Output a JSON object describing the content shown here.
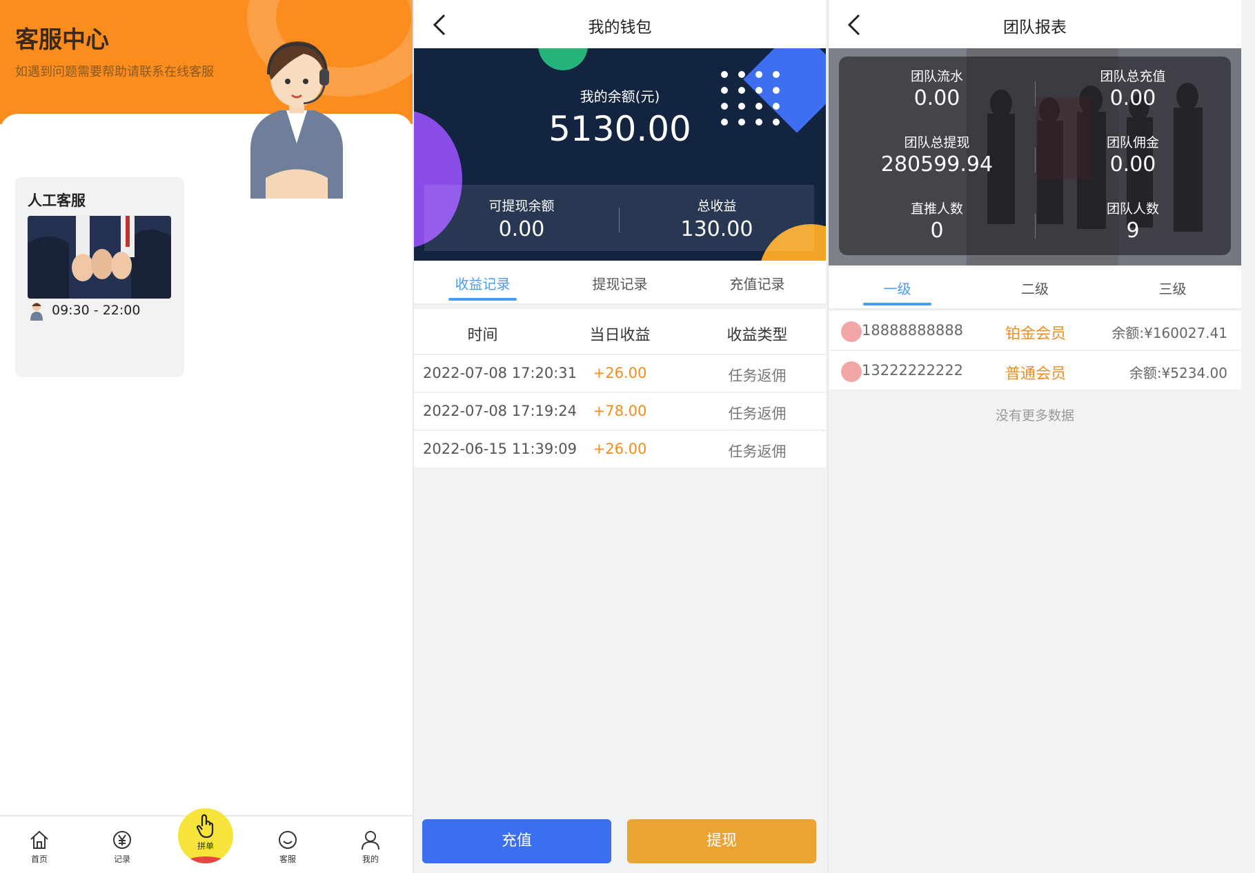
{
  "service": {
    "title": "客服中心",
    "subtitle": "如遇到问题需要帮助请联系在线客服",
    "card_title": "人工客服",
    "hours": "09:30 - 22:00",
    "tabs": [
      {
        "label": "首页",
        "icon": "home-icon"
      },
      {
        "label": "记录",
        "icon": "yen-record-icon"
      },
      {
        "label": "拼单",
        "icon": "tap-hand-icon"
      },
      {
        "label": "客服",
        "icon": "chat-icon"
      },
      {
        "label": "我的",
        "icon": "user-icon"
      }
    ]
  },
  "wallet": {
    "title": "我的钱包",
    "balance_label": "我的余额(元)",
    "balance": "5130.00",
    "withdrawable_label": "可提现余额",
    "withdrawable": "0.00",
    "total_earnings_label": "总收益",
    "total_earnings": "130.00",
    "tabs": [
      "收益记录",
      "提现记录",
      "充值记录"
    ],
    "active_tab": 0,
    "columns": [
      "时间",
      "当日收益",
      "收益类型"
    ],
    "records": [
      {
        "time": "2022-07-08 17:20:31",
        "amount": "+26.00",
        "type": "任务返佣"
      },
      {
        "time": "2022-07-08 17:19:24",
        "amount": "+78.00",
        "type": "任务返佣"
      },
      {
        "time": "2022-06-15 11:39:09",
        "amount": "+26.00",
        "type": "任务返佣"
      }
    ],
    "recharge_label": "充值",
    "withdraw_label": "提现",
    "colors": {
      "recharge": "#3b6ff0",
      "withdraw": "#eba333",
      "amount": "#f18c1d",
      "active_tab": "#4a9bf2"
    }
  },
  "team": {
    "title": "团队报表",
    "stats": [
      {
        "label": "团队流水",
        "value": "0.00"
      },
      {
        "label": "团队总充值",
        "value": "0.00"
      },
      {
        "label": "团队总提现",
        "value": "280599.94"
      },
      {
        "label": "团队佣金",
        "value": "0.00"
      },
      {
        "label": "直推人数",
        "value": "0"
      },
      {
        "label": "团队人数",
        "value": "9"
      }
    ],
    "tabs": [
      "一级",
      "二级",
      "三级"
    ],
    "active_tab": 0,
    "members": [
      {
        "phone": "18888888888",
        "level": "铂金会员",
        "balance": "余额:¥160027.41"
      },
      {
        "phone": "13222222222",
        "level": "普通会员",
        "balance": "余额:¥5234.00"
      }
    ],
    "no_more": "没有更多数据"
  }
}
